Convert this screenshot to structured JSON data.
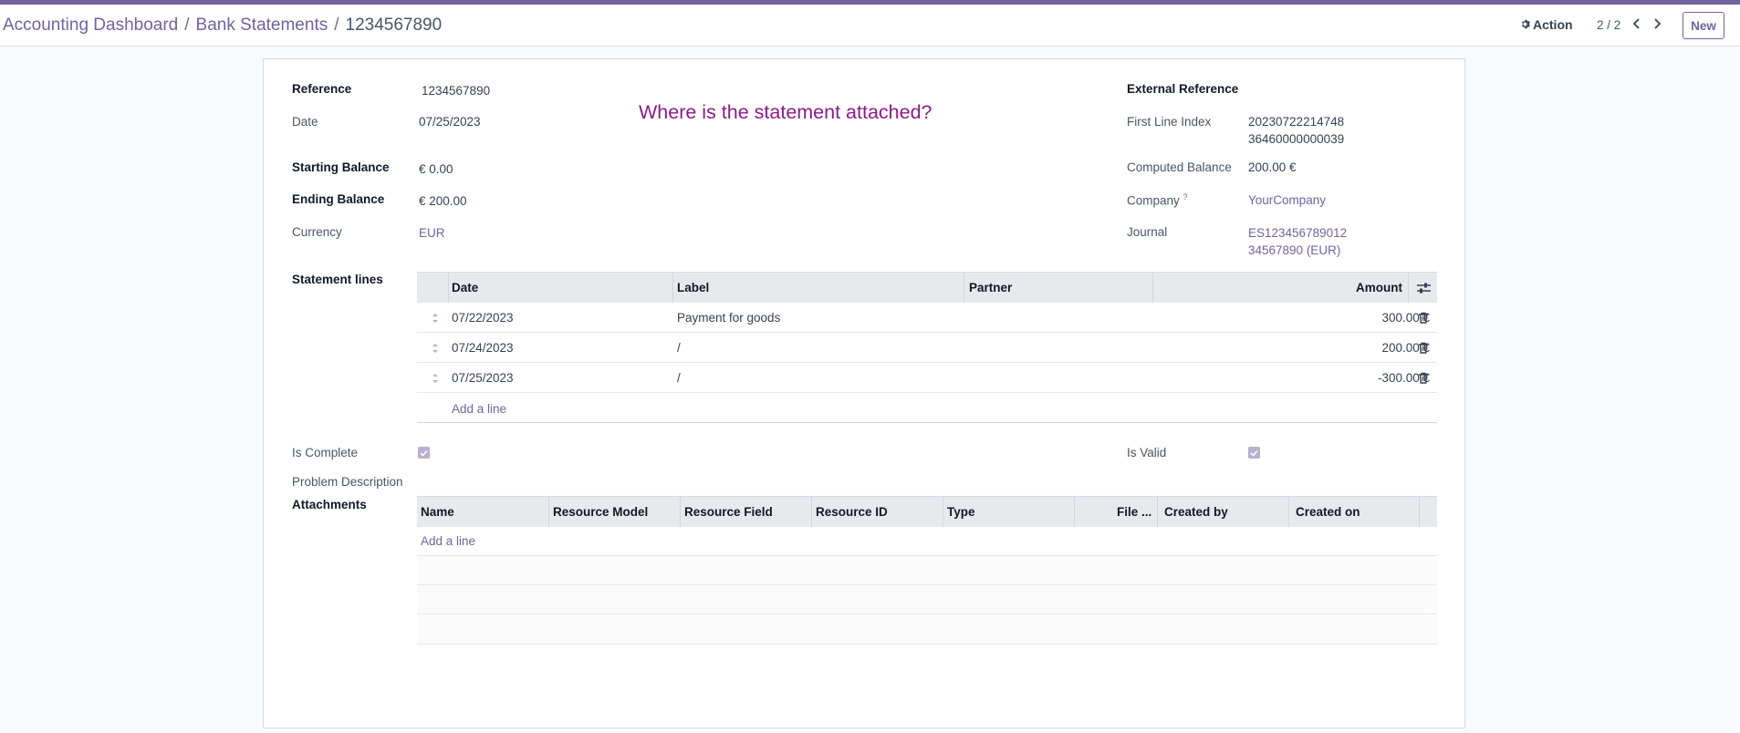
{
  "breadcrumb": {
    "items": [
      "Accounting Dashboard",
      "Bank Statements"
    ],
    "separator": "/",
    "current": "1234567890"
  },
  "toolbar": {
    "action_label": "Action",
    "pager": "2 / 2",
    "new_label": "New"
  },
  "overlay_question": "Where is the statement attached?",
  "form": {
    "left": [
      {
        "label": "Reference",
        "value": "1234567890"
      },
      {
        "label": "Date",
        "value": "07/25/2023"
      },
      {
        "label": "Starting Balance",
        "value": "€ 0.00"
      },
      {
        "label": "Ending Balance",
        "value": "€ 200.00"
      },
      {
        "label": "Currency",
        "value": "EUR"
      }
    ],
    "right": {
      "external_reference_label": "External Reference",
      "first_line_index_label": "First Line Index",
      "first_line_index_value": [
        "20230722214748",
        "36460000000039"
      ],
      "computed_balance_label": "Computed Balance",
      "computed_balance_value": "200.00 €",
      "company_label": "Company",
      "company_help": "?",
      "company_value": "YourCompany",
      "journal_label": "Journal",
      "journal_value": [
        "ES123456789012",
        "34567890 (EUR)"
      ]
    }
  },
  "statement_lines": {
    "label": "Statement lines",
    "columns": [
      "Date",
      "Label",
      "Partner",
      "Amount"
    ],
    "rows": [
      {
        "date": "07/22/2023",
        "label": "Payment for goods",
        "partner": "",
        "amount": "300.00 €"
      },
      {
        "date": "07/24/2023",
        "label": "/",
        "partner": "",
        "amount": "200.00 €"
      },
      {
        "date": "07/25/2023",
        "label": "/",
        "partner": "",
        "amount": "-300.00 €"
      }
    ],
    "add_line": "Add a line"
  },
  "flags": {
    "is_complete_label": "Is Complete",
    "is_complete": true,
    "is_valid_label": "Is Valid",
    "is_valid": true,
    "problem_description_label": "Problem Description"
  },
  "attachments": {
    "label": "Attachments",
    "columns": [
      "Name",
      "Resource Model",
      "Resource Field",
      "Resource ID",
      "Type",
      "File ...",
      "Created by",
      "Created on"
    ],
    "add_line": "Add a line"
  },
  "colors": {
    "brand": "#71639e",
    "question": "#8b1a89",
    "header_bg": "#e7e9ed"
  }
}
